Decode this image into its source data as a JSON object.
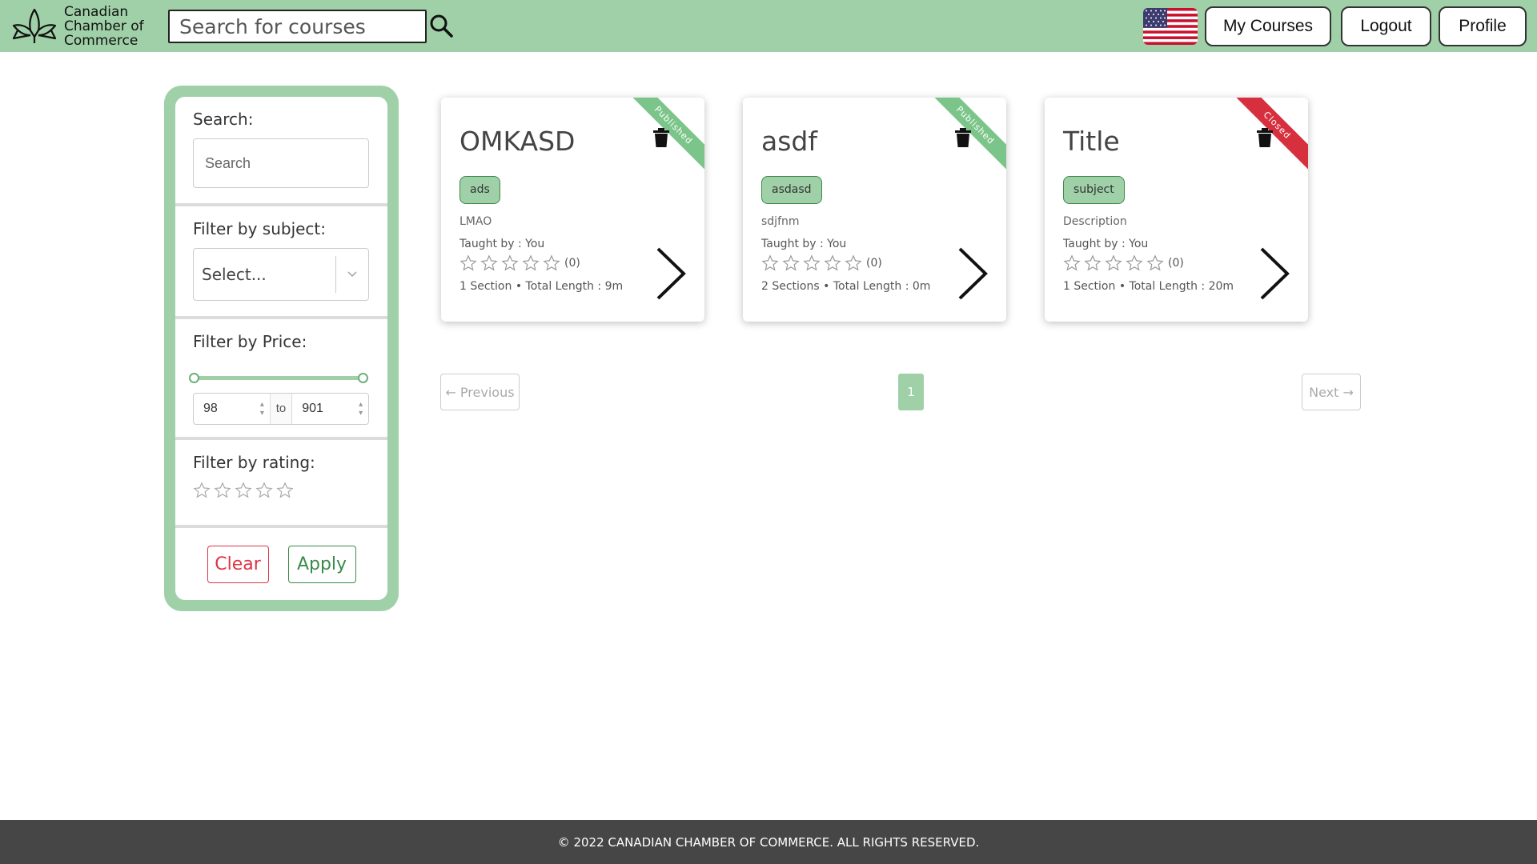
{
  "header": {
    "brand_name": "Canadian Chamber of Commerce",
    "search_placeholder": "Search for courses",
    "nav": {
      "my_courses": "My Courses",
      "logout": "Logout",
      "profile": "Profile"
    }
  },
  "sidebar": {
    "search_title": "Search:",
    "search_placeholder": "Search",
    "subject_title": "Filter by subject:",
    "subject_value": "Select...",
    "price_title": "Filter by Price:",
    "price_min": "98",
    "price_to": "to",
    "price_max": "901",
    "rating_title": "Filter by rating:",
    "clear_label": "Clear",
    "apply_label": "Apply"
  },
  "courses": [
    {
      "title": "OMKASD",
      "status": "Published",
      "tag": "ads",
      "description": "LMAO",
      "taught_by": "Taught by : You",
      "rating_count": "(0)",
      "meta": "1 Section • Total Length : 9m"
    },
    {
      "title": "asdf",
      "status": "Published",
      "tag": "asdasd",
      "description": "sdjfnm",
      "taught_by": "Taught by : You",
      "rating_count": "(0)",
      "meta": "2 Sections • Total Length : 0m"
    },
    {
      "title": "Title",
      "status": "Closed",
      "tag": "subject",
      "description": "Description",
      "taught_by": "Taught by : You",
      "rating_count": "(0)",
      "meta": "1 Section • Total Length : 20m"
    }
  ],
  "pagination": {
    "previous": "← Previous",
    "current": "1",
    "next": "Next →"
  },
  "footer": {
    "copyright": "© 2022 CANADIAN CHAMBER OF COMMERCE. ALL RIGHTS RESERVED."
  },
  "colors": {
    "brand_green": "#9fd0a7",
    "published_ribbon": "#7cc58a",
    "closed_ribbon": "#d6303f",
    "footer_bg": "#464646"
  }
}
